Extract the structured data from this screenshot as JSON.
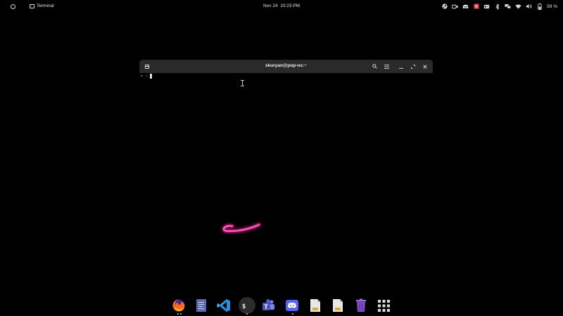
{
  "topbar": {
    "workspaces_icon": "workspaces-circle-icon",
    "app_menu": {
      "icon": "terminal-icon",
      "label": "Terminal"
    },
    "clock": {
      "date": "Nov 24",
      "time": "10:23 PM"
    },
    "tray": {
      "icons": [
        "steam-icon",
        "camera-icon",
        "discord-icon",
        "notification-badge-icon",
        "controller-icon",
        "bluetooth-icon",
        "network-icon",
        "wifi-icon",
        "volume-icon",
        "battery-icon"
      ],
      "battery_label": "59 %"
    }
  },
  "terminal": {
    "title": "skuryan@pop-os:~",
    "prompt_arrow": "➜",
    "prompt_dir": "~",
    "buttons": {
      "new_tab": "new-tab-icon",
      "search": "search-icon",
      "menu": "hamburger-menu-icon",
      "minimize": "minimize-icon",
      "maximize": "maximize-icon",
      "close": "close-icon"
    }
  },
  "dock": {
    "items": [
      {
        "name": "firefox",
        "icon": "firefox-icon",
        "running": true
      },
      {
        "name": "text-editor",
        "icon": "text-editor-icon",
        "running": false
      },
      {
        "name": "vscode",
        "icon": "vscode-icon",
        "running": false
      },
      {
        "name": "terminal",
        "icon": "terminal-icon",
        "running": true
      },
      {
        "name": "teams",
        "icon": "teams-icon",
        "running": false
      },
      {
        "name": "discord",
        "icon": "discord-icon",
        "running": true
      },
      {
        "name": "files-1",
        "icon": "document-icon",
        "running": false
      },
      {
        "name": "files-2",
        "icon": "document-icon",
        "running": false
      },
      {
        "name": "trash",
        "icon": "trash-icon",
        "running": false
      },
      {
        "name": "app-grid",
        "icon": "app-grid-icon",
        "running": false
      }
    ]
  },
  "colors": {
    "background": "#000000",
    "titlebar": "#2a2a2a",
    "prompt_arrow": "#3fcf3f",
    "prompt_dir": "#5ab3e6",
    "accent_pink": "#ff3da8"
  }
}
